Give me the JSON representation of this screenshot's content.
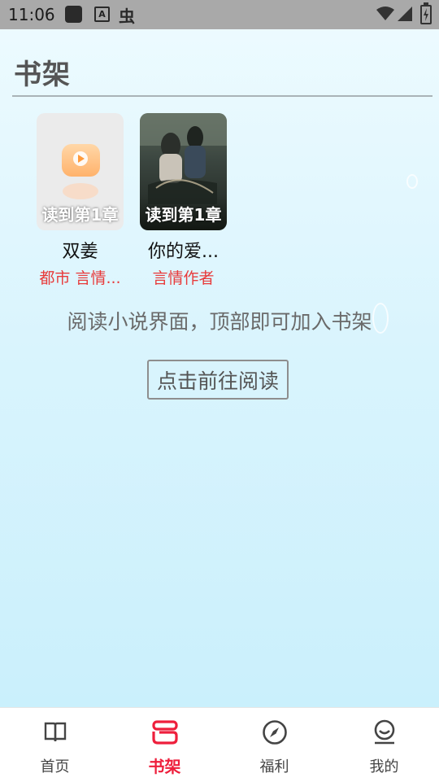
{
  "status": {
    "time": "11:06",
    "notification_icons": [
      "app-square-icon",
      "a-icon",
      "bug-icon"
    ],
    "system_icons": [
      "wifi-icon",
      "signal-icon",
      "battery-charging-icon"
    ]
  },
  "page": {
    "title": "书架"
  },
  "books": [
    {
      "title": "双姜",
      "tags": "都市 言情...",
      "badge": "读到第1章"
    },
    {
      "title": "你的爱...",
      "tags": "言情作者",
      "badge": "读到第1章"
    }
  ],
  "hint": "阅读小说界面，顶部即可加入书架",
  "goto_button": "点击前往阅读",
  "tabs": [
    {
      "label": "首页",
      "icon": "book-icon",
      "active": false
    },
    {
      "label": "书架",
      "icon": "bookshelf-icon",
      "active": true
    },
    {
      "label": "福利",
      "icon": "compass-icon",
      "active": false
    },
    {
      "label": "我的",
      "icon": "profile-icon",
      "active": false
    }
  ],
  "colors": {
    "accent": "#ee1f3c",
    "tag": "#e83a3a"
  }
}
